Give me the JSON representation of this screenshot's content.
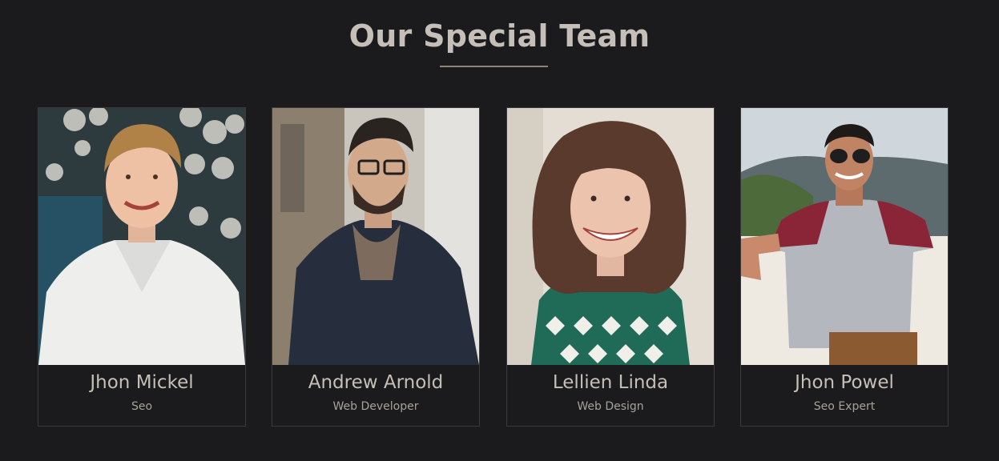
{
  "section": {
    "title": "Our Special Team"
  },
  "team": [
    {
      "name": "Jhon Mickel",
      "role": "Seo"
    },
    {
      "name": "Andrew Arnold",
      "role": "Web Developer"
    },
    {
      "name": "Lellien Linda",
      "role": "Web Design"
    },
    {
      "name": "Jhon Powel",
      "role": "Seo Expert"
    }
  ],
  "colors": {
    "background": "#1b1b1d",
    "heading": "#c5bfb7",
    "subtext": "#a8a29a",
    "accent_line": "#8d8477",
    "card_border": "#3a3a3c"
  }
}
